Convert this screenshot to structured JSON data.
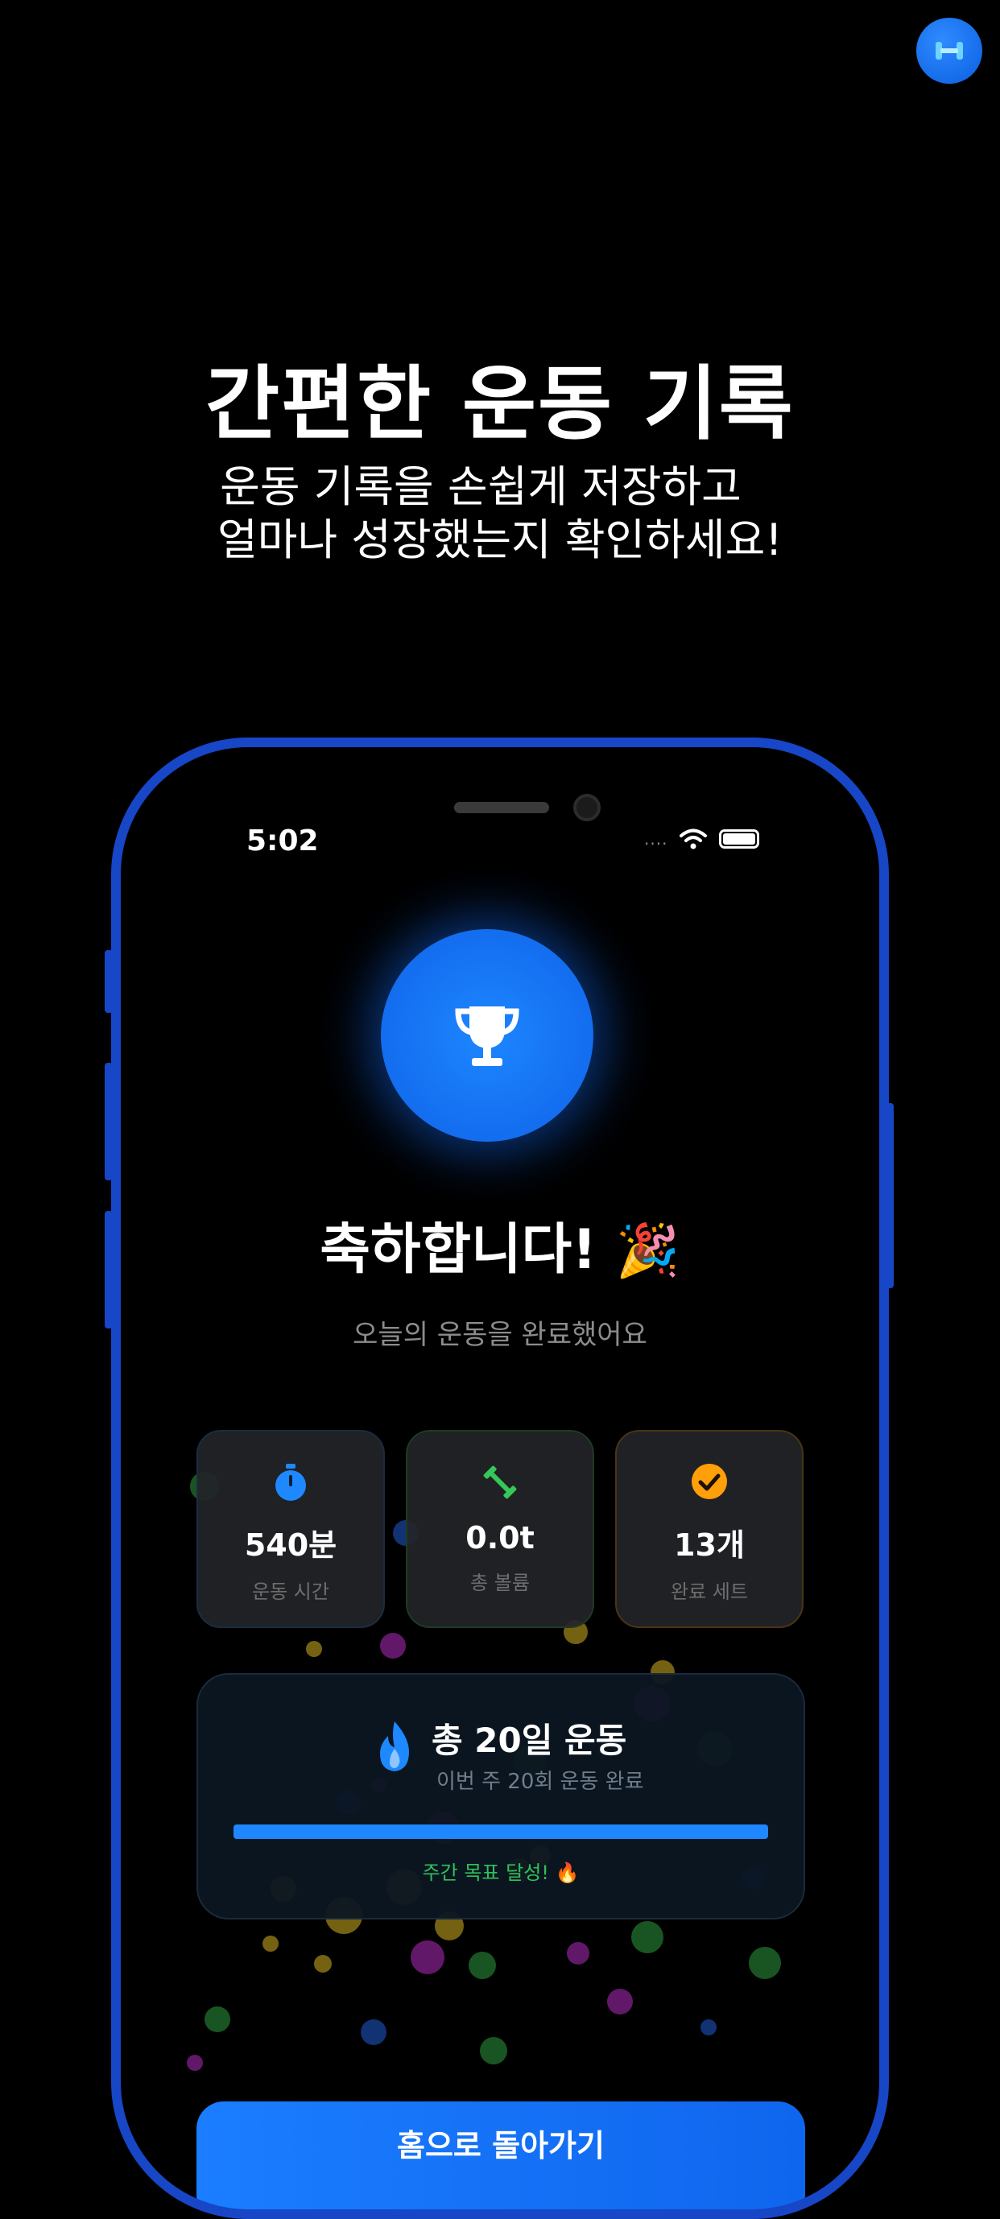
{
  "headline": "간편한 운동 기록",
  "subline": [
    "운동 기록을 손쉽게 저장하고",
    "얼마나 성장했는지 확인하세요!"
  ],
  "status": {
    "time": "5:02",
    "signal_dots": "....",
    "icons": [
      "wifi-icon",
      "battery-icon"
    ]
  },
  "celebration": {
    "title": "축하합니다!",
    "emoji": "🎉",
    "subtitle": "오늘의 운동을 완료했어요"
  },
  "stats": [
    {
      "icon": "stopwatch-icon",
      "value": "540분",
      "label": "운동 시간",
      "color": "#1e88ff"
    },
    {
      "icon": "dumbbell-icon",
      "value": "0.0t",
      "label": "총 볼륨",
      "color": "#35c759"
    },
    {
      "icon": "check-circle-icon",
      "value": "13개",
      "label": "완료 세트",
      "color": "#ff9f0a"
    }
  ],
  "streak": {
    "title": "총 20일 운동",
    "subtitle": "이번 주 20회 운동 완료",
    "progress": 1.0,
    "goal_text": "주간 목표 달성! 🔥"
  },
  "home_button": "홈으로 돌아가기",
  "colors": {
    "accent": "#1e88ff",
    "frame": "#1746c7",
    "success": "#2ec25a"
  }
}
